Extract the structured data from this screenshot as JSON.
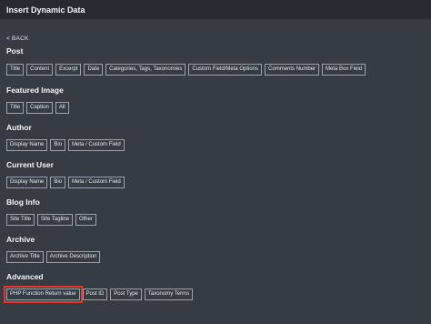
{
  "window": {
    "title": "Insert Dynamic Data"
  },
  "nav": {
    "back_label": "< BACK"
  },
  "sections": [
    {
      "title": "Post",
      "items": [
        "Title",
        "Content",
        "Excerpt",
        "Date",
        "Categories, Tags, Taxonomies",
        "Custom Field/Meta Options",
        "Comments Number",
        "Meta Box Field"
      ]
    },
    {
      "title": "Featured Image",
      "items": [
        "Title",
        "Caption",
        "Alt"
      ]
    },
    {
      "title": "Author",
      "items": [
        "Display Name",
        "Bio",
        "Meta / Custom Field"
      ]
    },
    {
      "title": "Current User",
      "items": [
        "Display Name",
        "Bio",
        "Meta / Custom Field"
      ]
    },
    {
      "title": "Blog Info",
      "items": [
        "Site Title",
        "Site Tagline",
        "Other"
      ]
    },
    {
      "title": "Archive",
      "items": [
        "Archive Title",
        "Archive Description"
      ]
    },
    {
      "title": "Advanced",
      "items": [
        "PHP Function Return value",
        "Post ID",
        "Post Type",
        "Taxonomy Terms"
      ]
    }
  ],
  "colors": {
    "background": "#353c43",
    "titlebar": "#262b31",
    "chip_border": "#9aa3ab",
    "highlight": "#e23a2a"
  }
}
